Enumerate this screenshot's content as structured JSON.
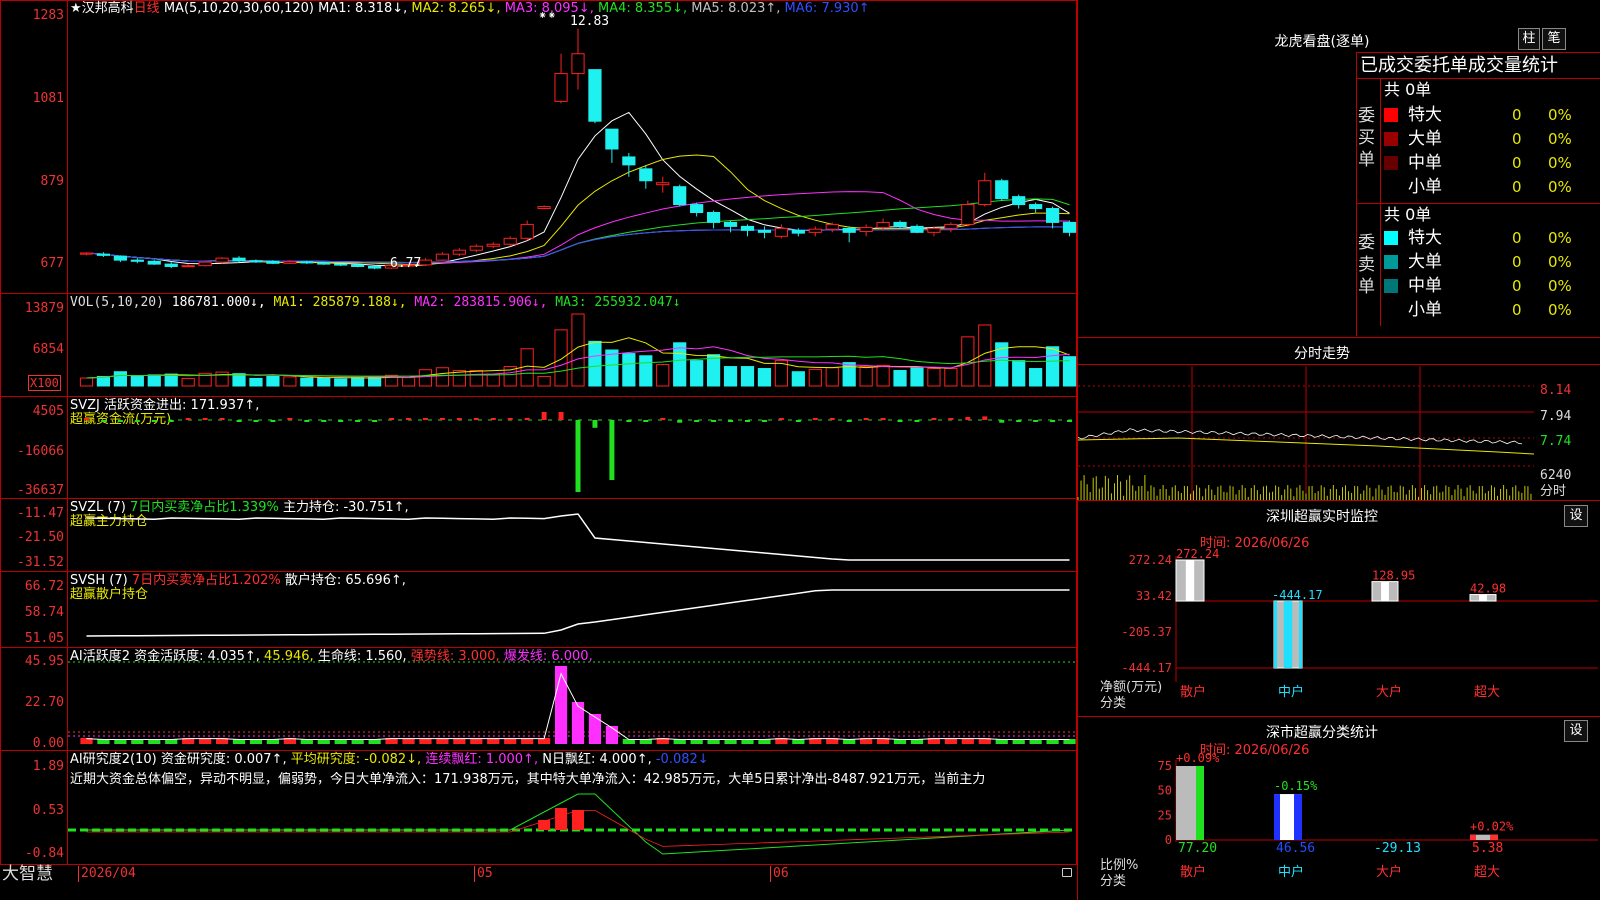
{
  "colors": {
    "up": "#ff2020",
    "down": "#1ff0f0",
    "ma1": "#ffffff",
    "ma2": "#e8e800",
    "ma3": "#ff30ff",
    "ma4": "#20e020",
    "ma5": "#c0c0c0",
    "ma6": "#3050ff",
    "grid": "#b00000"
  },
  "main": {
    "header": {
      "star": "★",
      "name": "汉邦高科",
      "period": "日线",
      "ma": "MA(5,10,20,30,60,120)",
      "ma1": "MA1: 8.318↓,",
      "ma2": "MA2: 8.265↓,",
      "ma3": "MA3: 8.095↓,",
      "ma4": "MA4: 8.355↓,",
      "ma5": "MA5: 8.023↑,",
      "ma6": "MA6: 7.930↑"
    },
    "yticks": [
      "1283",
      "1081",
      "879",
      "677"
    ],
    "high_note": "12.83",
    "low_note": "6.77",
    "high_marker": "⁕⁕"
  },
  "vol": {
    "header": "VOL(5,10,20)",
    "v": "186781.000↓,",
    "ma1": "MA1: 285879.188↓,",
    "ma2": "MA2: 283815.906↓,",
    "ma3": "MA3: 255932.047↓",
    "yticks": [
      "13879",
      "6854"
    ],
    "unit": "X100"
  },
  "svzj": {
    "header": "SVZJ",
    "sub": "活跃资金进出: 171.937↑,",
    "title": "超赢资金流(万元)",
    "yticks": [
      "4505",
      "-16066",
      "-36637"
    ]
  },
  "svzl": {
    "header": "SVZL (7)",
    "sub": "7日内买卖净占比1.339%",
    "sub2": "主力持仓: -30.751↑,",
    "title": "超赢主力持仓",
    "yticks": [
      "-11.47",
      "-21.50",
      "-31.52"
    ]
  },
  "svsh": {
    "header": "SVSH (7)",
    "sub": "7日内买卖净占比1.202%",
    "sub2": "散户持仓: 65.696↑,",
    "title": "超赢散户持仓",
    "yticks": [
      "66.72",
      "58.74",
      "51.05"
    ]
  },
  "ai1": {
    "header": "AI活跃度2",
    "a": "资金活跃度: 4.035↑,",
    "b": "45.946,",
    "c": "生命线: 1.560,",
    "d": "强势线: 3.000,",
    "e": "爆发线: 6.000,",
    "yticks": [
      "45.95",
      "22.70",
      "0.00"
    ]
  },
  "ai2": {
    "header": "AI研究度2(10)",
    "a": "资金研究度: 0.007↑,",
    "b": "平均研究度: -0.082↓,",
    "c": "连续飘红: 1.000↑,",
    "d": "N日飘红: 4.000↑,",
    "e": "-0.082↓",
    "note": "近期大资金总体偏空，异动不明显，偏弱势，今日大单净流入：171.938万元，其中特大单净流入：42.985万元，大单5日累计净出-8487.921万元，当前主力",
    "yticks": [
      "1.89",
      "0.53",
      "-0.84"
    ]
  },
  "xaxis": {
    "labels": [
      "2026/04",
      "05",
      "06"
    ],
    "brand": "大智慧"
  },
  "dragon": {
    "title": "龙虎看盘(逐单)",
    "btn_a": "柱",
    "btn_b": "笔",
    "header": "已成交委托单成交量统计",
    "buy": {
      "side": "委买单",
      "total": "共 0单",
      "rows": [
        {
          "name": "特大",
          "n": "0",
          "p": "0%",
          "c": "#ff0000"
        },
        {
          "name": "大单",
          "n": "0",
          "p": "0%",
          "c": "#990000"
        },
        {
          "name": "中单",
          "n": "0",
          "p": "0%",
          "c": "#660000"
        },
        {
          "name": "小单",
          "n": "0",
          "p": "0%",
          "c": ""
        }
      ]
    },
    "sell": {
      "side": "委卖单",
      "total": "共 0单",
      "rows": [
        {
          "name": "特大",
          "n": "0",
          "p": "0%",
          "c": "#00ffff"
        },
        {
          "name": "大单",
          "n": "0",
          "p": "0%",
          "c": "#009999"
        },
        {
          "name": "中单",
          "n": "0",
          "p": "0%",
          "c": "#007777"
        },
        {
          "name": "小单",
          "n": "0",
          "p": "0%",
          "c": ""
        }
      ]
    }
  },
  "intraday": {
    "title": "分时走势",
    "prices": [
      "8.14",
      "7.94",
      "7.74"
    ],
    "vol": "6240",
    "vol_lbl": "分时"
  },
  "sz_monitor": {
    "title": "深圳超赢实时监控",
    "set": "设",
    "time": "时间: 2026/06/26",
    "yticks": [
      "272.24",
      "33.42",
      "-205.37",
      "-444.17"
    ],
    "net": "净额(万元)",
    "cls": "分类"
  },
  "sz_stats": {
    "title": "深市超赢分类统计",
    "set": "设",
    "time": "时间: 2026/06/26",
    "yticks": [
      "75",
      "50",
      "25",
      "0"
    ],
    "ratio": "比例%",
    "cls": "分类"
  },
  "chart_data": [
    {
      "type": "bar",
      "title": "深圳超赢实时监控",
      "categories": [
        "散户",
        "中户",
        "大户",
        "超大"
      ],
      "values": [
        272.24,
        -444.17,
        128.95,
        42.98
      ],
      "ylabel": "净额(万元)",
      "ylim": [
        -444.17,
        272.24
      ]
    },
    {
      "type": "bar",
      "title": "深市超赢分类统计",
      "categories": [
        "散户",
        "中户",
        "大户",
        "超大"
      ],
      "values": [
        77.2,
        46.56,
        -29.13,
        5.38
      ],
      "ratios": [
        "+0.09%",
        "-0.15%",
        "",
        "+0.02%"
      ],
      "ylabel": "比例%",
      "ylim": [
        0,
        75
      ]
    },
    {
      "type": "candlestick",
      "title": "汉邦高科 日线",
      "ylim": [
        6.77,
        12.83
      ],
      "candles": [
        [
          7.15,
          7.18,
          7.12,
          7.2
        ],
        [
          7.15,
          7.12,
          7.08,
          7.2
        ],
        [
          7.1,
          7.0,
          6.95,
          7.12
        ],
        [
          7.0,
          6.97,
          6.92,
          7.05
        ],
        [
          6.97,
          6.9,
          6.88,
          7.0
        ],
        [
          6.9,
          6.84,
          6.8,
          6.95
        ],
        [
          6.84,
          6.86,
          6.82,
          6.9
        ],
        [
          6.86,
          6.95,
          6.84,
          6.98
        ],
        [
          6.95,
          7.05,
          6.92,
          7.08
        ],
        [
          7.05,
          6.98,
          6.95,
          7.1
        ],
        [
          6.98,
          6.97,
          6.93,
          7.02
        ],
        [
          6.97,
          6.92,
          6.9,
          7.0
        ],
        [
          6.92,
          6.96,
          6.9,
          7.0
        ],
        [
          6.96,
          6.93,
          6.9,
          6.98
        ],
        [
          6.93,
          6.9,
          6.88,
          6.96
        ],
        [
          6.9,
          6.88,
          6.85,
          6.92
        ],
        [
          6.88,
          6.84,
          6.82,
          6.9
        ],
        [
          6.84,
          6.8,
          6.77,
          6.86
        ],
        [
          6.8,
          6.86,
          6.78,
          6.9
        ],
        [
          6.86,
          6.88,
          6.82,
          6.92
        ],
        [
          6.88,
          7.0,
          6.85,
          7.05
        ],
        [
          7.0,
          7.15,
          6.98,
          7.2
        ],
        [
          7.15,
          7.25,
          7.1,
          7.3
        ],
        [
          7.25,
          7.35,
          7.2,
          7.4
        ],
        [
          7.35,
          7.4,
          7.3,
          7.45
        ],
        [
          7.4,
          7.55,
          7.35,
          7.6
        ],
        [
          7.55,
          7.9,
          7.5,
          8.0
        ],
        [
          8.3,
          8.35,
          8.28,
          8.38
        ],
        [
          11.0,
          11.7,
          10.95,
          12.2
        ],
        [
          11.7,
          12.2,
          11.3,
          12.83
        ],
        [
          11.8,
          10.5,
          10.45,
          11.8
        ],
        [
          10.3,
          9.8,
          9.45,
          10.3
        ],
        [
          9.6,
          9.4,
          9.1,
          9.7
        ],
        [
          9.3,
          9.0,
          8.8,
          9.4
        ],
        [
          8.9,
          8.95,
          8.7,
          9.1
        ],
        [
          8.85,
          8.4,
          8.35,
          8.9
        ],
        [
          8.4,
          8.2,
          8.1,
          8.45
        ],
        [
          8.2,
          7.95,
          7.8,
          8.25
        ],
        [
          7.95,
          7.85,
          7.7,
          8.0
        ],
        [
          7.85,
          7.75,
          7.6,
          7.9
        ],
        [
          7.75,
          7.7,
          7.55,
          7.85
        ],
        [
          7.6,
          7.8,
          7.55,
          7.9
        ],
        [
          7.75,
          7.68,
          7.6,
          7.8
        ],
        [
          7.7,
          7.78,
          7.6,
          7.85
        ],
        [
          7.78,
          7.9,
          7.7,
          7.95
        ],
        [
          7.8,
          7.7,
          7.45,
          7.85
        ],
        [
          7.72,
          7.82,
          7.6,
          7.9
        ],
        [
          7.82,
          7.95,
          7.75,
          8.05
        ],
        [
          7.95,
          7.85,
          7.8,
          8.0
        ],
        [
          7.85,
          7.7,
          7.68,
          7.9
        ],
        [
          7.7,
          7.8,
          7.6,
          7.85
        ],
        [
          7.8,
          7.9,
          7.7,
          7.95
        ],
        [
          7.9,
          8.4,
          7.85,
          8.5
        ],
        [
          8.4,
          9.0,
          8.35,
          9.2
        ],
        [
          9.0,
          8.55,
          8.5,
          9.05
        ],
        [
          8.6,
          8.4,
          8.3,
          8.65
        ],
        [
          8.4,
          8.3,
          8.2,
          8.45
        ],
        [
          8.3,
          7.95,
          7.8,
          8.35
        ],
        [
          7.95,
          7.7,
          7.6,
          8.0
        ]
      ]
    }
  ]
}
